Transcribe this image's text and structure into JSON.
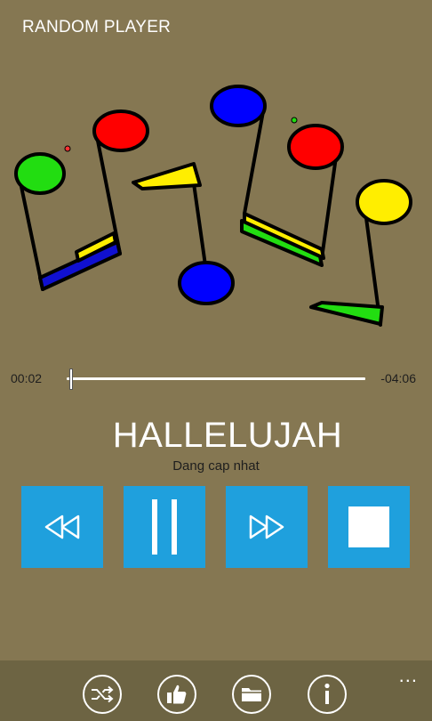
{
  "app": {
    "title": "RANDOM PLAYER"
  },
  "player": {
    "elapsed": "00:02",
    "remaining": "-04:06",
    "progress": 0.008,
    "song_title": "HALLELUJAH",
    "status": "Dang cap nhat"
  },
  "controls": [
    {
      "name": "rewind-button",
      "icon": "rewind-icon"
    },
    {
      "name": "pause-button",
      "icon": "pause-icon"
    },
    {
      "name": "fast-forward-button",
      "icon": "fast-forward-icon"
    },
    {
      "name": "stop-button",
      "icon": "stop-icon"
    }
  ],
  "appbar": {
    "buttons": [
      {
        "name": "shuffle-button",
        "icon": "shuffle-icon"
      },
      {
        "name": "like-button",
        "icon": "thumbs-up-icon"
      },
      {
        "name": "folder-button",
        "icon": "folder-icon"
      },
      {
        "name": "info-button",
        "icon": "info-icon"
      }
    ],
    "more": "..."
  },
  "colors": {
    "background": "#857752",
    "accent": "#1fa0dd",
    "appbar": "#6d6443",
    "note_green": "#22dd11",
    "note_red": "#ff0000",
    "note_blue": "#0000ff",
    "note_yellow": "#ffee00"
  }
}
